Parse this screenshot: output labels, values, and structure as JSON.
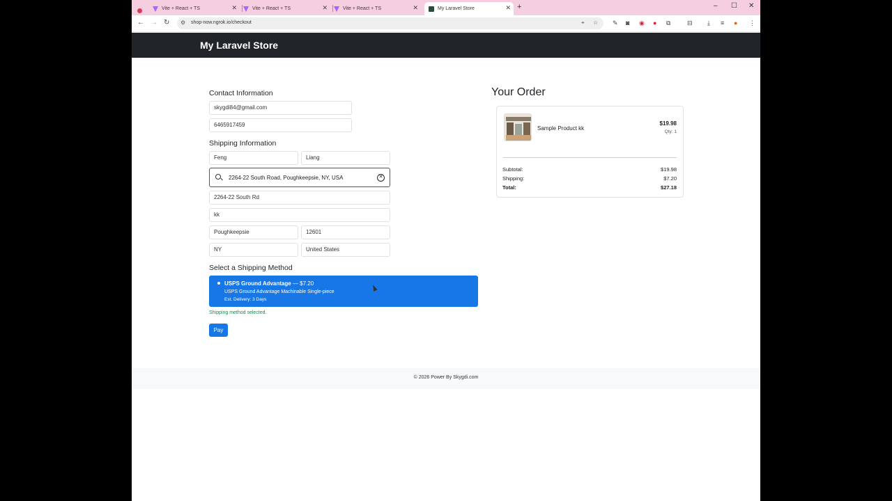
{
  "browser": {
    "tabs": [
      {
        "label": "Vite + React + TS"
      },
      {
        "label": "Vite + React + TS"
      },
      {
        "label": "Vite + React + TS"
      },
      {
        "label": "My Laravel Store"
      }
    ],
    "url": "shop-now.ngrok.io/checkout"
  },
  "navbar": {
    "brand": "My Laravel Store"
  },
  "contact": {
    "heading": "Contact Information",
    "email": "skygdi84@gmail.com",
    "phone": "6465917459"
  },
  "shipping": {
    "heading": "Shipping Information",
    "first_name": "Feng",
    "last_name": "Liang",
    "address_search": "2264-22 South Road, Poughkeepsie, NY, USA",
    "address1": "2264-22 South Rd",
    "address2": "kk",
    "city": "Poughkeepsie",
    "zip": "12601",
    "state": "NY",
    "country": "United States"
  },
  "shipping_method": {
    "heading": "Select a Shipping Method",
    "name": "USPS Ground Advantage",
    "price": " — $7.20",
    "description": "USPS Ground Advantage Machinable Single-piece",
    "delivery": "Est. Delivery: 3 Days",
    "status": "Shipping method selected.",
    "pay_label": "Pay"
  },
  "order": {
    "heading": "Your Order",
    "item_name": "Sample Product kk",
    "item_price": "$19.98",
    "item_qty": "Qty: 1",
    "subtotal_label": "Subtotal:",
    "subtotal": "$19.98",
    "shipping_label": "Shipping:",
    "shipping": "$7.20",
    "total_label": "Total:",
    "total": "$27.18"
  },
  "footer": {
    "text": "© 2026 Power By Skygdi.com"
  }
}
